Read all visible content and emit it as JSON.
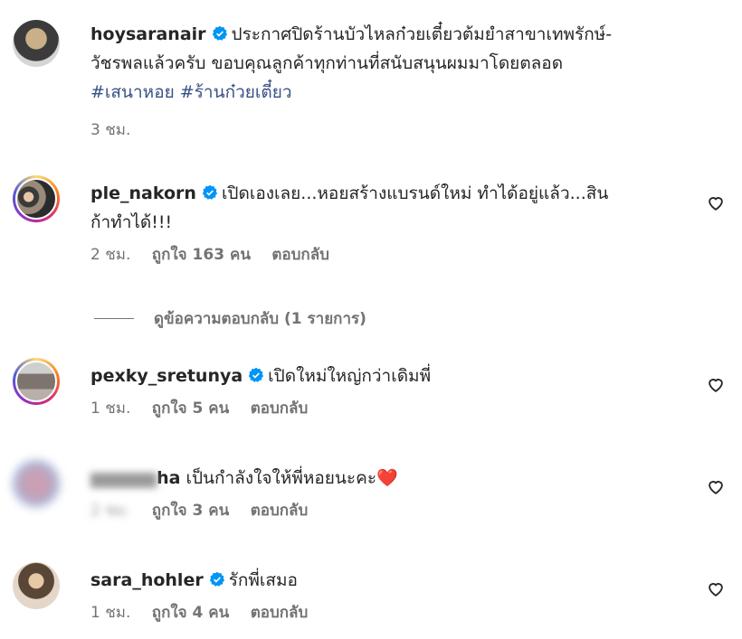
{
  "colors": {
    "text": "#262626",
    "muted": "#737373",
    "hashtag": "#385185",
    "verified": "#0095f6",
    "heart": "#e8365d"
  },
  "caption": {
    "username": "hoysaranair",
    "text_line1": "ประกาศปิดร้านบัวไหลก๋วยเตี๋ยวต้มยำสาขาเทพรักษ์-",
    "text_line2": "วัชรพลแล้วครับ ขอบคุณลูกค้าทุกท่านที่สนับสนุนผมมาโดยตลอด",
    "hashtag1": "#เสนาหอย",
    "hashtag2": "#ร้านก๋วยเตี๋ยว",
    "time": "3 ชม."
  },
  "comments": [
    {
      "username": "ple_nakorn",
      "text_line1": "เปิดเองเลย...หอยสร้างแบรนด์ใหม่ ทำได้อยู่แล้ว...สิน",
      "text_line2": "ก้าทำได้!!!",
      "time": "2 ชม.",
      "likes": "ถูกใจ 163 คน",
      "reply": "ตอบกลับ"
    },
    {
      "username": "pexky_sretunya",
      "text": "เปิดใหม่ใหญ่กว่าเดิมพี่",
      "time": "1 ชม.",
      "likes": "ถูกใจ 5 คน",
      "reply": "ตอบกลับ"
    },
    {
      "username": "ha",
      "text": "เป็นกำลังใจให้พี่หอยนะคะ❤️",
      "time": "2 ชม.",
      "likes": "ถูกใจ 3 คน",
      "reply": "ตอบกลับ"
    },
    {
      "username": "sara_hohler",
      "text": "รักพี่เสมอ",
      "time": "1 ชม.",
      "likes": "ถูกใจ 4 คน",
      "reply": "ตอบกลับ"
    }
  ],
  "view_replies": "ดูข้อความตอบกลับ (1 รายการ)"
}
